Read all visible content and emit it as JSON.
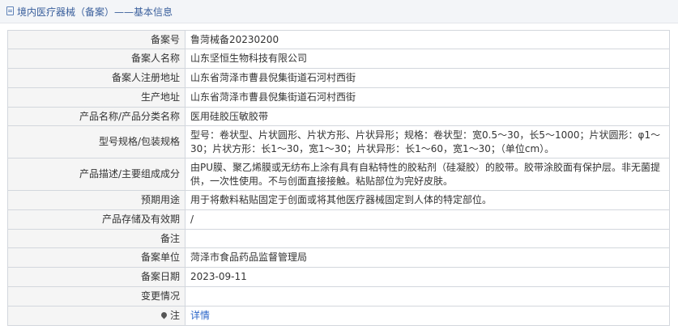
{
  "header": {
    "title": "境内医疗器械（备案）——基本信息"
  },
  "fields": [
    {
      "label": "备案号",
      "value": "鲁菏械备20230200"
    },
    {
      "label": "备案人名称",
      "value": "山东坚恒生物科技有限公司"
    },
    {
      "label": "备案人注册地址",
      "value": "山东省菏泽市曹县倪集街道石河村西街"
    },
    {
      "label": "生产地址",
      "value": "山东省菏泽市曹县倪集街道石河村西街"
    },
    {
      "label": "产品名称/产品分类名称",
      "value": "医用硅胶压敏胶带"
    },
    {
      "label": "型号规格/包装规格",
      "value": "型号：卷状型、片状圆形、片状方形、片状异形；规格：卷状型：宽0.5～30，长5～1000；片状圆形：φ1～30；片状方形：长1～30，宽1～30；片状异形：长1～60，宽1～30；（单位cm）。"
    },
    {
      "label": "产品描述/主要组成成分",
      "value": "由PU膜、聚乙烯膜或无纺布上涂有具有自粘特性的胶粘剂（硅凝胶）的胶带。胶带涂胶面有保护层。非无菌提供，一次性使用。不与创面直接接触。粘贴部位为完好皮肤。"
    },
    {
      "label": "预期用途",
      "value": "用于将敷料粘贴固定于创面或将其他医疗器械固定到人体的特定部位。"
    },
    {
      "label": "产品存储及有效期",
      "value": "/"
    },
    {
      "label": "备注",
      "value": ""
    },
    {
      "label": "备案单位",
      "value": "菏泽市食品药品监督管理局"
    },
    {
      "label": "备案日期",
      "value": "2023-09-11"
    },
    {
      "label": "变更情况",
      "value": ""
    }
  ],
  "note_row": {
    "label": "注",
    "link_text": "详情"
  }
}
